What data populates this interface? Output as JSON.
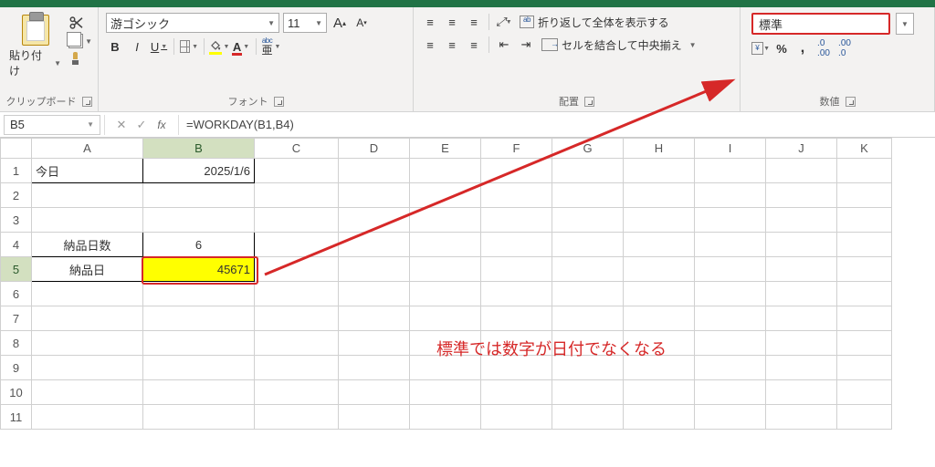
{
  "ribbon": {
    "clipboard": {
      "paste": "貼り付け",
      "label": "クリップボード"
    },
    "font": {
      "name": "游ゴシック",
      "size": "11",
      "bold": "B",
      "italic": "I",
      "underline": "U",
      "label": "フォント"
    },
    "alignment": {
      "wrap": "折り返して全体を表示する",
      "merge": "セルを結合して中央揃え",
      "label": "配置"
    },
    "number": {
      "format": "標準",
      "label": "数値",
      "percent": "%",
      "comma": ","
    }
  },
  "formula": {
    "cell_ref": "B5",
    "value": "=WORKDAY(B1,B4)"
  },
  "cols": [
    "A",
    "B",
    "C",
    "D",
    "E",
    "F",
    "G",
    "H",
    "I",
    "J",
    "K"
  ],
  "rows": [
    "1",
    "2",
    "3",
    "4",
    "5",
    "6",
    "7",
    "8",
    "9",
    "10",
    "11"
  ],
  "cells": {
    "A1": "今日",
    "B1": "2025/1/6",
    "A4": "納品日数",
    "B4": "6",
    "A5": "納品日",
    "B5": "45671"
  },
  "annotation": "標準では数字が日付でなくなる"
}
